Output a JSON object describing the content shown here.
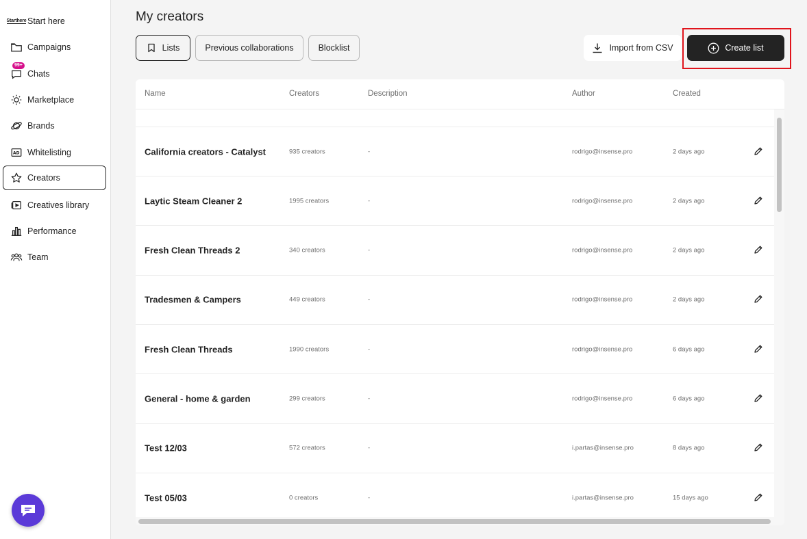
{
  "sidebar": {
    "start_icon_text": [
      "Start",
      "here"
    ],
    "chats_badge": "99+",
    "items": [
      {
        "label": "Start here",
        "icon": "start-here-icon"
      },
      {
        "label": "Campaigns",
        "icon": "folder-icon"
      },
      {
        "label": "Chats",
        "icon": "chat-icon"
      },
      {
        "label": "Marketplace",
        "icon": "sun-icon"
      },
      {
        "label": "Brands",
        "icon": "planet-icon"
      },
      {
        "label": "Whitelisting",
        "icon": "ad-icon"
      },
      {
        "label": "Creators",
        "icon": "star-icon"
      },
      {
        "label": "Creatives library",
        "icon": "video-library-icon"
      },
      {
        "label": "Performance",
        "icon": "bar-chart-icon"
      },
      {
        "label": "Team",
        "icon": "team-icon"
      }
    ]
  },
  "header": {
    "title": "My creators",
    "tabs": [
      {
        "label": "Lists",
        "icon": "bookmark-icon"
      },
      {
        "label": "Previous collaborations"
      },
      {
        "label": "Blocklist"
      }
    ],
    "import_label": "Import from CSV",
    "create_label": "Create list"
  },
  "table": {
    "columns": [
      "Name",
      "Creators",
      "Description",
      "Author",
      "Created"
    ],
    "rows": [
      {
        "name": "California creators - Catalyst",
        "creators": "935 creators",
        "description": "-",
        "author": "rodrigo@insense.pro",
        "created": "2 days ago"
      },
      {
        "name": "Laytic Steam Cleaner 2",
        "creators": "1995 creators",
        "description": "-",
        "author": "rodrigo@insense.pro",
        "created": "2 days ago"
      },
      {
        "name": "Fresh Clean Threads 2",
        "creators": "340 creators",
        "description": "-",
        "author": "rodrigo@insense.pro",
        "created": "2 days ago"
      },
      {
        "name": "Tradesmen & Campers",
        "creators": "449 creators",
        "description": "-",
        "author": "rodrigo@insense.pro",
        "created": "2 days ago"
      },
      {
        "name": "Fresh Clean Threads",
        "creators": "1990 creators",
        "description": "-",
        "author": "rodrigo@insense.pro",
        "created": "6 days ago"
      },
      {
        "name": "General - home & garden",
        "creators": "299 creators",
        "description": "-",
        "author": "rodrigo@insense.pro",
        "created": "6 days ago"
      },
      {
        "name": "Test 12/03",
        "creators": "572 creators",
        "description": "-",
        "author": "i.partas@insense.pro",
        "created": "8 days ago"
      },
      {
        "name": "Test 05/03",
        "creators": "0 creators",
        "description": "-",
        "author": "i.partas@insense.pro",
        "created": "15 days ago"
      }
    ]
  },
  "colors": {
    "accent_dark": "#232323",
    "chat_fab": "#5b3ad8",
    "badge": "#d6108b",
    "highlight": "#e0141c"
  }
}
